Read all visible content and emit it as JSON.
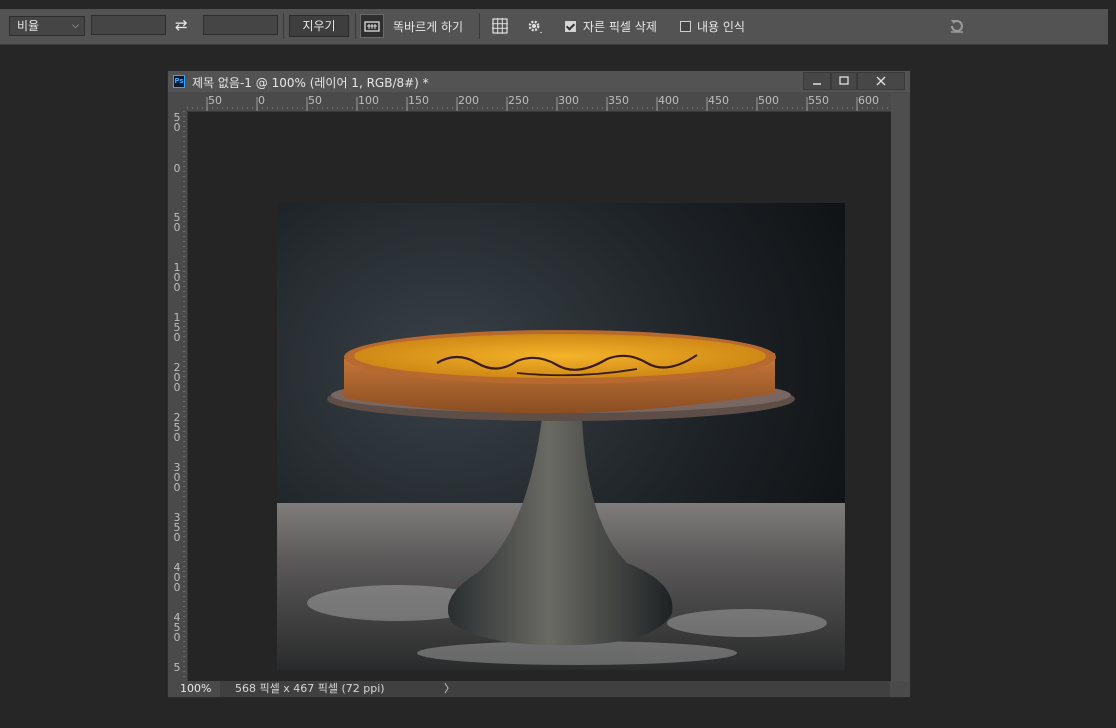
{
  "options_bar": {
    "ratio_select": "비율",
    "clear_label": "지우기",
    "straighten_label": "똑바르게 하기",
    "delete_cropped_label": "자른 픽셀 삭제",
    "delete_cropped_checked": true,
    "content_aware_label": "내용 인식",
    "content_aware_checked": false
  },
  "document": {
    "title": "제목 없음-1 @ 100% (레이어 1, RGB/8#) *",
    "ps_badge": "Ps",
    "ruler_h_labels": [
      "50",
      "0",
      "50",
      "100",
      "150",
      "200",
      "250",
      "300",
      "350",
      "400",
      "450",
      "500",
      "550",
      "600"
    ],
    "ruler_v_labels": [
      "50",
      "0",
      "50",
      "100",
      "150",
      "200",
      "250",
      "300",
      "350",
      "400",
      "450",
      "5"
    ],
    "status_zoom": "100%",
    "status_info": "568 픽셀 x 467 픽셀 (72 ppi)",
    "status_arrow": "〉"
  },
  "colors": {
    "app_bg": "#262626",
    "panel": "#535353",
    "canvas_bg": "#252525",
    "ps_blue": "#31a8ff"
  }
}
